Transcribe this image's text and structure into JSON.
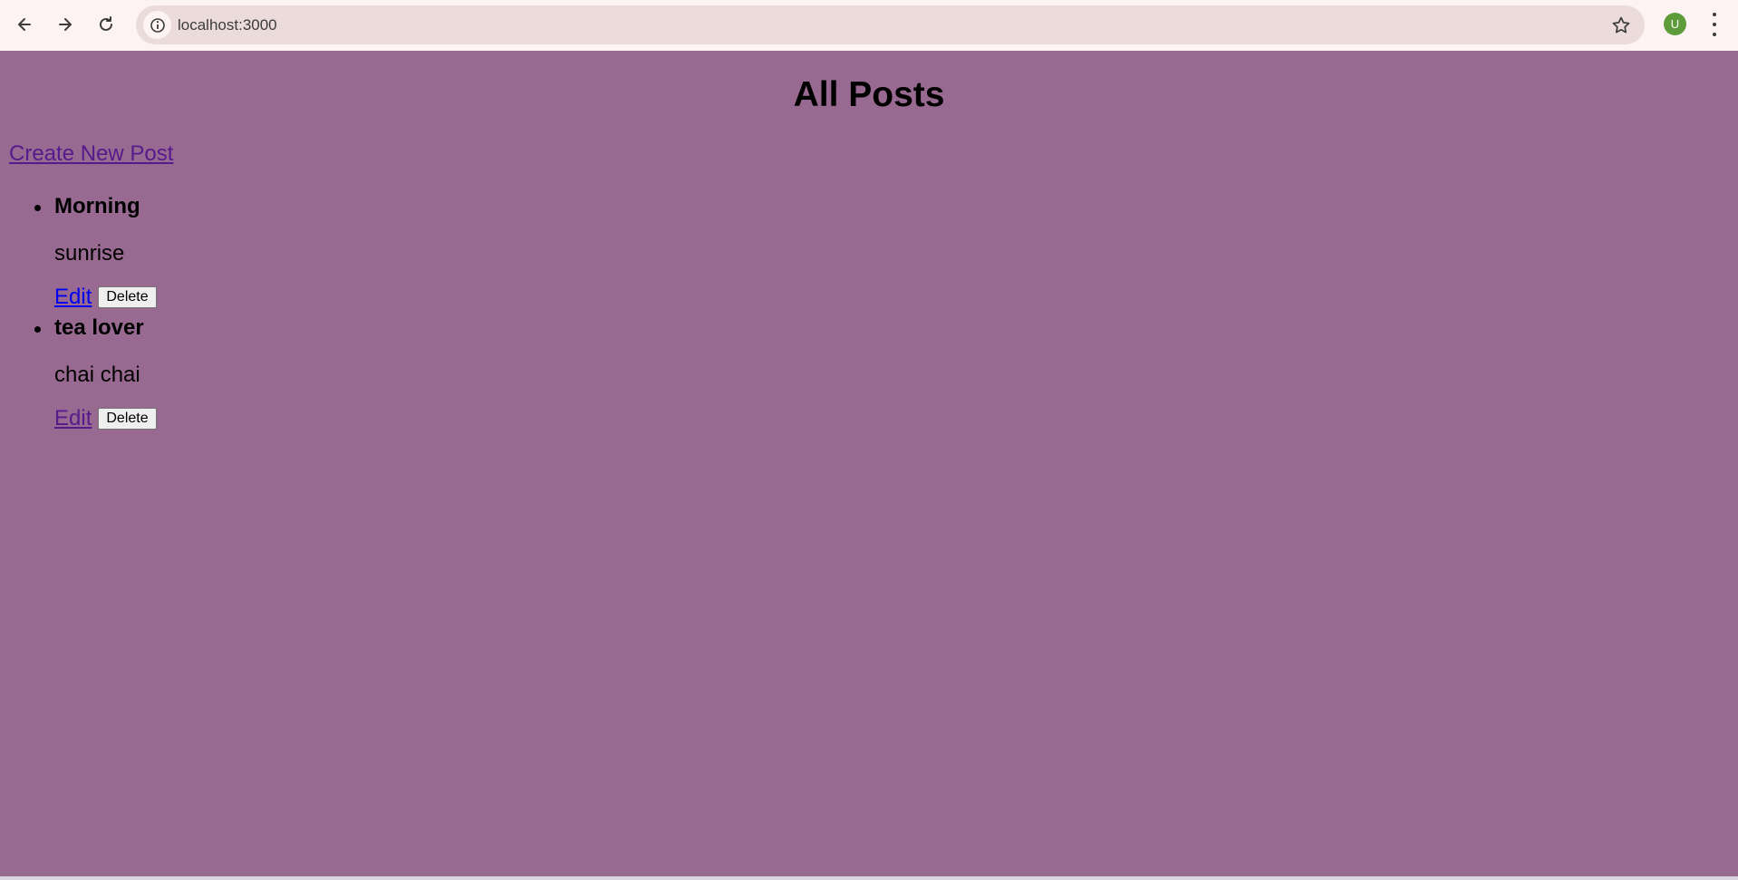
{
  "browser": {
    "url": "localhost:3000",
    "profile_initial": "U",
    "profile_color": "#5e9b3a",
    "icons": {
      "back": "back-arrow-icon",
      "forward": "forward-arrow-icon",
      "reload": "reload-icon",
      "site_info": "info-icon",
      "bookmark": "star-icon",
      "menu": "kebab-menu-icon"
    }
  },
  "page": {
    "background": "#996a91",
    "heading": "All Posts",
    "create_link": "Create New Post",
    "posts": [
      {
        "title": "Morning",
        "content": "sunrise",
        "edit_label": "Edit",
        "delete_label": "Delete",
        "edit_link_visited": false
      },
      {
        "title": "tea lover",
        "content": "chai chai",
        "edit_label": "Edit",
        "delete_label": "Delete",
        "edit_link_visited": true
      }
    ]
  }
}
